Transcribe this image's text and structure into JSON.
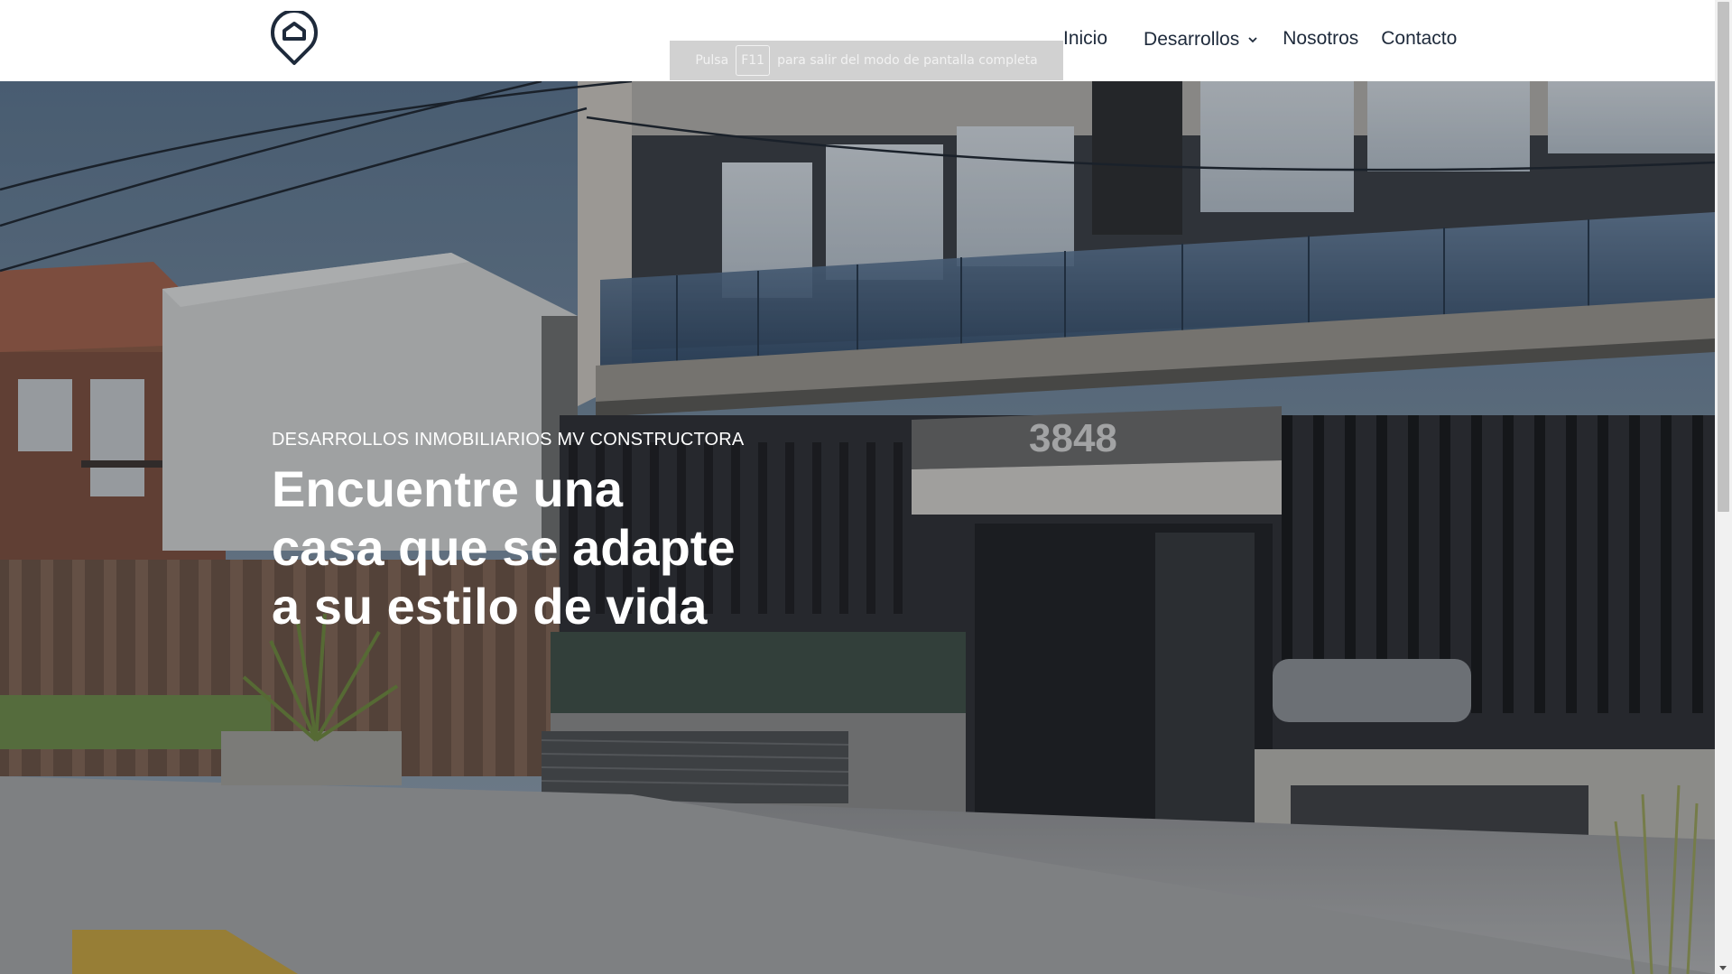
{
  "header": {
    "logo_icon": "house-location-pin-icon",
    "nav": [
      {
        "label": "Inicio"
      },
      {
        "label": "Desarrollos",
        "icon": "chevron-down-icon"
      },
      {
        "label": "Nosotros"
      },
      {
        "label": "Contacto"
      }
    ]
  },
  "toast": {
    "prefix": "Pulsa",
    "key": "F11",
    "suffix": "para salir del modo de pantalla completa"
  },
  "hero": {
    "eyebrow": "DESARROLLOS INMOBILIARIOS MV CONSTRUCTORA",
    "title_lines": [
      "Encuentre una",
      "casa que se adapte",
      "a su estilo de vida"
    ],
    "building_number": "3848"
  },
  "colors": {
    "nav_text": "#1e2a3b",
    "hero_text": "#ffffff",
    "header_bg": "#ffffff"
  }
}
